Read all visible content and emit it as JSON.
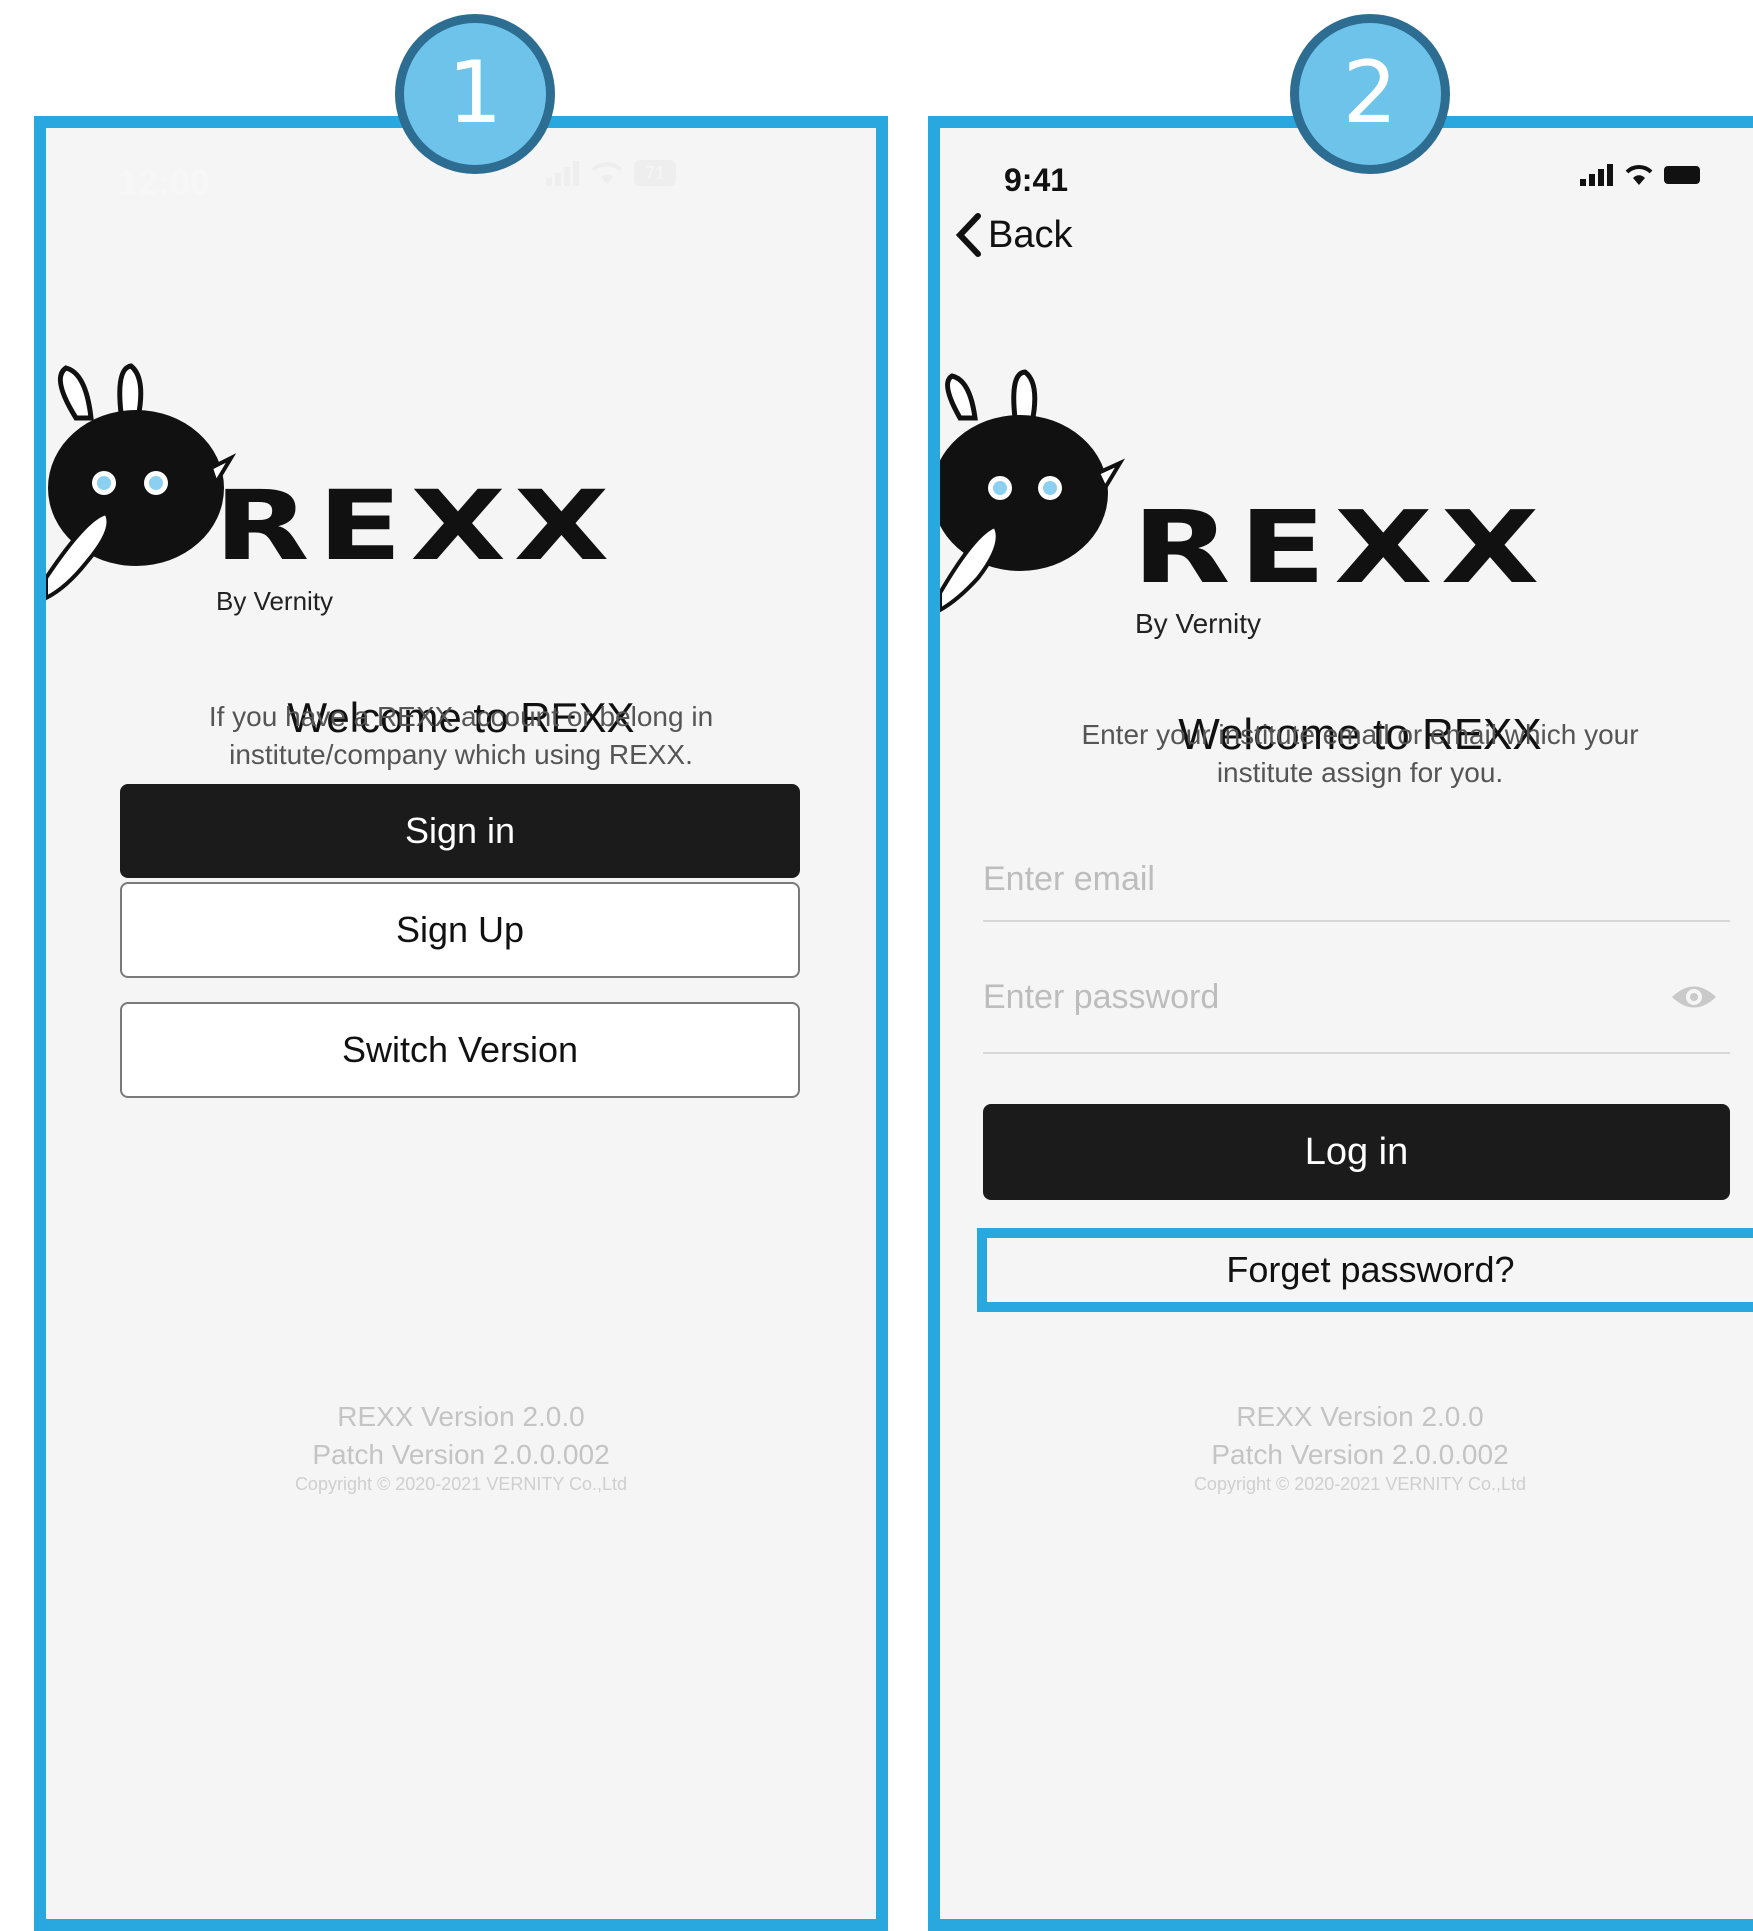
{
  "steps": [
    "1",
    "2"
  ],
  "screen1": {
    "status": {
      "time": "12:00",
      "battery": "71"
    },
    "logo": {
      "wordmark": "REXX",
      "byline": "By Vernity"
    },
    "welcome_title": "Welcome to REXX",
    "subtitle_line1": "If you have a REXX account or belong in",
    "subtitle_line2": "institute/company which using REXX.",
    "buttons": {
      "sign_in": "Sign in",
      "sign_up": "Sign Up",
      "switch_version": "Switch Version"
    },
    "footer": {
      "version": "REXX Version 2.0.0",
      "patch": "Patch Version 2.0.0.002",
      "copyright": "Copyright © 2020-2021 VERNITY Co.,Ltd"
    }
  },
  "screen2": {
    "status": {
      "time": "9:41"
    },
    "back_label": "Back",
    "logo": {
      "wordmark": "REXX",
      "byline": "By Vernity"
    },
    "welcome_title": "Welcome to REXX",
    "subtitle_line1": "Enter your institute email or email which your",
    "subtitle_line2": "institute assign for you.",
    "email_placeholder": "Enter email",
    "password_placeholder": "Enter password",
    "login_label": "Log in",
    "forget_label": "Forget password?",
    "footer": {
      "version": "REXX Version 2.0.0",
      "patch": "Patch Version 2.0.0.002",
      "copyright": "Copyright © 2020-2021 VERNITY Co.,Ltd"
    }
  },
  "colors": {
    "highlight": "#29a8df",
    "badge_fill": "#6ec3ea",
    "badge_ring": "#2c6d91",
    "button_dark": "#1b1b1b"
  }
}
